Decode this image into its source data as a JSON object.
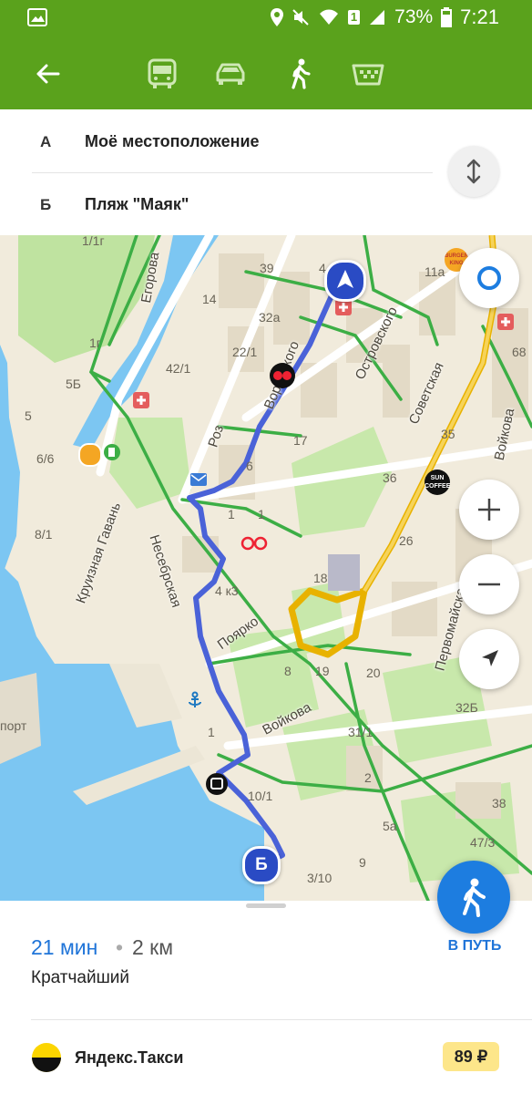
{
  "status_bar": {
    "battery_percent": "73%",
    "time": "7:21",
    "sim_badge": "1",
    "icons": [
      "gallery-icon",
      "location-icon",
      "mute-icon",
      "wifi-icon",
      "signal-icon",
      "battery-icon"
    ]
  },
  "transport_modes": [
    "bus-icon",
    "car-icon",
    "walk-icon",
    "taxi-icon"
  ],
  "active_mode": "walk",
  "route": {
    "from_letter": "А",
    "from": "Моё местоположение",
    "to_letter": "Б",
    "to": "Пляж \"Маяк\""
  },
  "map": {
    "end_marker_letter": "Б",
    "streets": [
      "Егорова",
      "Воровского",
      "Островского",
      "Советская",
      "Войкова",
      "Круизная Гавань",
      "Несебрская",
      "Поярко",
      "Войкова",
      "Первомайская",
      "Роз"
    ],
    "house_numbers": [
      "1/1г",
      "39",
      "4",
      "11а",
      "14",
      "32а",
      "1г",
      "22/1",
      "42/1",
      "5Б",
      "5",
      "6/6",
      "17",
      "35",
      "6",
      "36",
      "1",
      "1",
      "8/1",
      "26",
      "18",
      "4 к3",
      "8",
      "19",
      "20",
      "32Б",
      "1",
      "31/1",
      "2",
      "10/1",
      "38",
      "5а",
      "47/3",
      "9",
      "3/10",
      "68",
      "порт"
    ],
    "poi_labels": [
      "SUN COFFEE",
      "BURGER KING"
    ]
  },
  "summary": {
    "time": "21 мин",
    "separator": "•",
    "distance": "2 км",
    "route_type": "Кратчайший",
    "go_label": "В ПУТЬ"
  },
  "taxi": {
    "name": "Яндекс.Такси",
    "price": "89 ₽"
  },
  "colors": {
    "accent": "#5aa21c",
    "route": "#4a62d8",
    "link": "#1f74d8"
  }
}
